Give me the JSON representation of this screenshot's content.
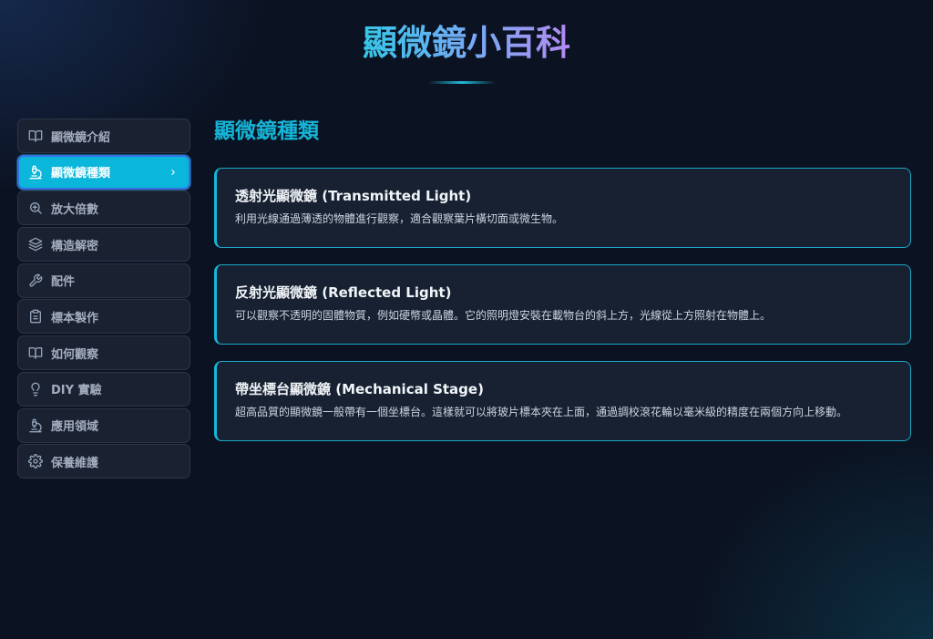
{
  "header": {
    "title": "顯微鏡小百科"
  },
  "sidebar": {
    "items": [
      {
        "label": "顯微鏡介紹",
        "icon": "book-open-icon"
      },
      {
        "label": "顯微鏡種類",
        "icon": "microscope-icon",
        "active": true
      },
      {
        "label": "放大倍數",
        "icon": "zoom-in-icon"
      },
      {
        "label": "構造解密",
        "icon": "layers-icon"
      },
      {
        "label": "配件",
        "icon": "wrench-icon"
      },
      {
        "label": "標本製作",
        "icon": "clipboard-icon"
      },
      {
        "label": "如何觀察",
        "icon": "book-open-icon"
      },
      {
        "label": "DIY 實驗",
        "icon": "lightbulb-icon"
      },
      {
        "label": "應用領域",
        "icon": "microscope-icon"
      },
      {
        "label": "保養維護",
        "icon": "gear-icon"
      }
    ]
  },
  "main": {
    "section_title": "顯微鏡種類",
    "cards": [
      {
        "title": "透射光顯微鏡 (Transmitted Light)",
        "description": "利用光線通過薄透的物體進行觀察，適合觀察葉片橫切面或微生物。"
      },
      {
        "title": "反射光顯微鏡 (Reflected Light)",
        "description": "可以觀察不透明的固體物質，例如硬幣或晶體。它的照明燈安裝在載物台的斜上方，光線從上方照射在物體上。"
      },
      {
        "title": "帶坐標台顯微鏡 (Mechanical Stage)",
        "description": "超高品質的顯微鏡一般帶有一個坐標台。這樣就可以將玻片標本夾在上面，通過調校滾花輪以毫米級的精度在兩個方向上移動。"
      }
    ]
  },
  "colors": {
    "accent": "#0ab6d9",
    "active_border": "#3b6ce8",
    "section_title": "#15b4d6",
    "background": "#0b1322"
  }
}
